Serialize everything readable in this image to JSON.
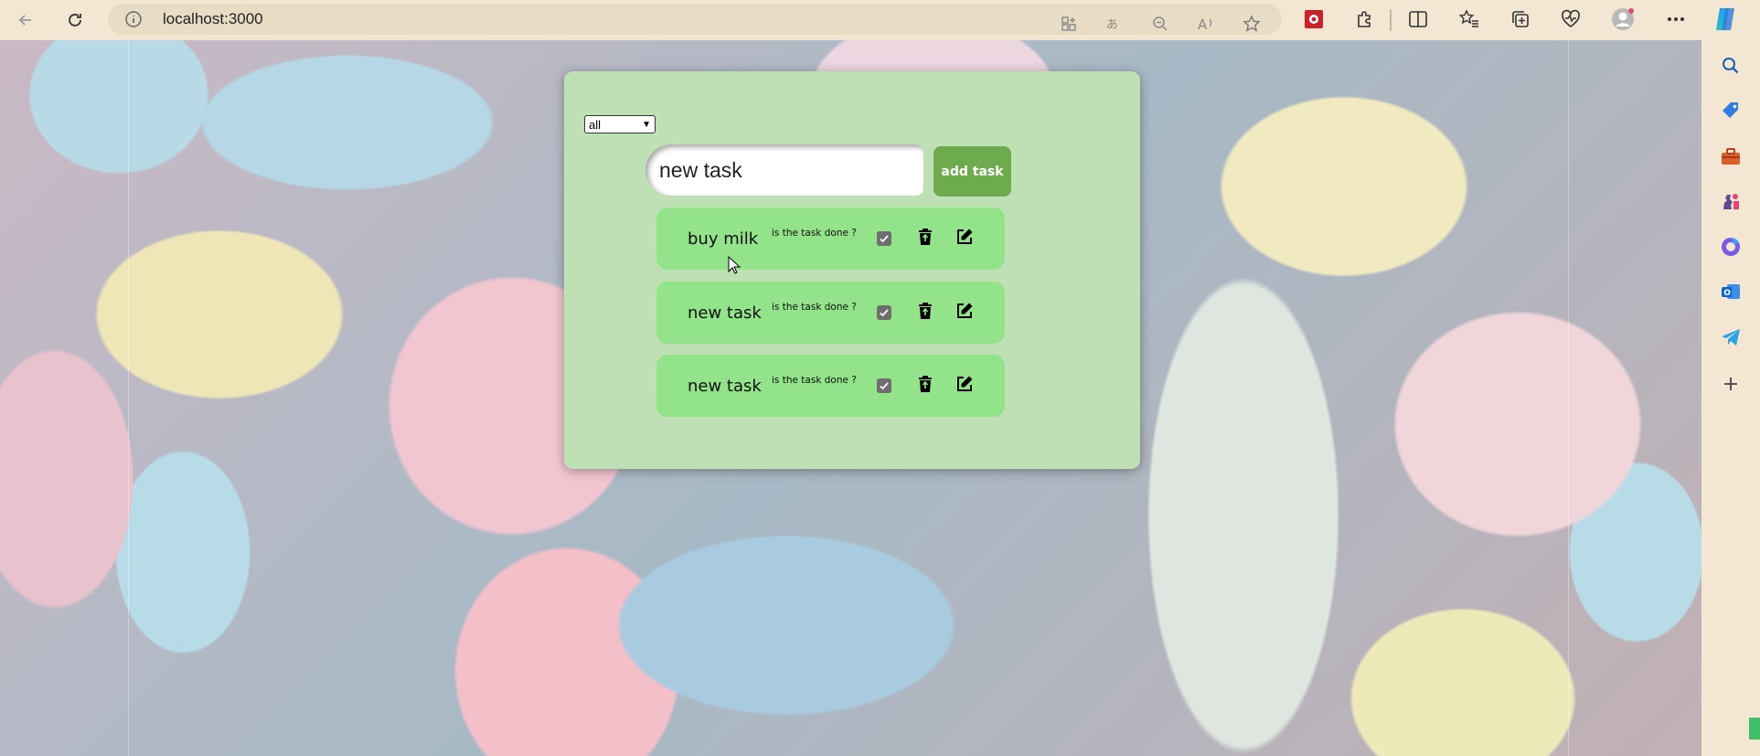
{
  "browser": {
    "url": "localhost:3000"
  },
  "app": {
    "filter": {
      "selected": "all"
    },
    "new_task_input": {
      "value": "new task"
    },
    "add_button_label": "add task",
    "tasks": [
      {
        "name": "buy milk",
        "done_question": "is the task done ?",
        "done": true
      },
      {
        "name": "new task",
        "done_question": "is the task done ?",
        "done": true
      },
      {
        "name": "new task",
        "done_question": "is the task done ?",
        "done": true
      }
    ]
  },
  "icons": {
    "toolbar": [
      "back-icon",
      "refresh-icon",
      "info-icon",
      "apps-icon",
      "translate-icon",
      "zoom-out-icon",
      "read-aloud-icon",
      "favorite-star-icon",
      "extension-red-icon",
      "extensions-puzzle-icon",
      "split-screen-icon",
      "favorites-icon",
      "collections-icon",
      "browser-essentials-icon",
      "profile-icon",
      "more-icon",
      "copilot-icon"
    ],
    "sidebar": [
      "search-icon",
      "shopping-tag-icon",
      "tools-icon",
      "games-icon",
      "microsoft365-icon",
      "outlook-icon",
      "telegram-icon",
      "add-icon"
    ],
    "task_actions": [
      "checkbox",
      "trash-icon",
      "edit-icon"
    ]
  },
  "colors": {
    "card_bg": "#bfe0b4",
    "task_bg": "#92e38a",
    "add_button_bg": "#6dab4e",
    "browser_chrome": "#f3e6d2"
  }
}
